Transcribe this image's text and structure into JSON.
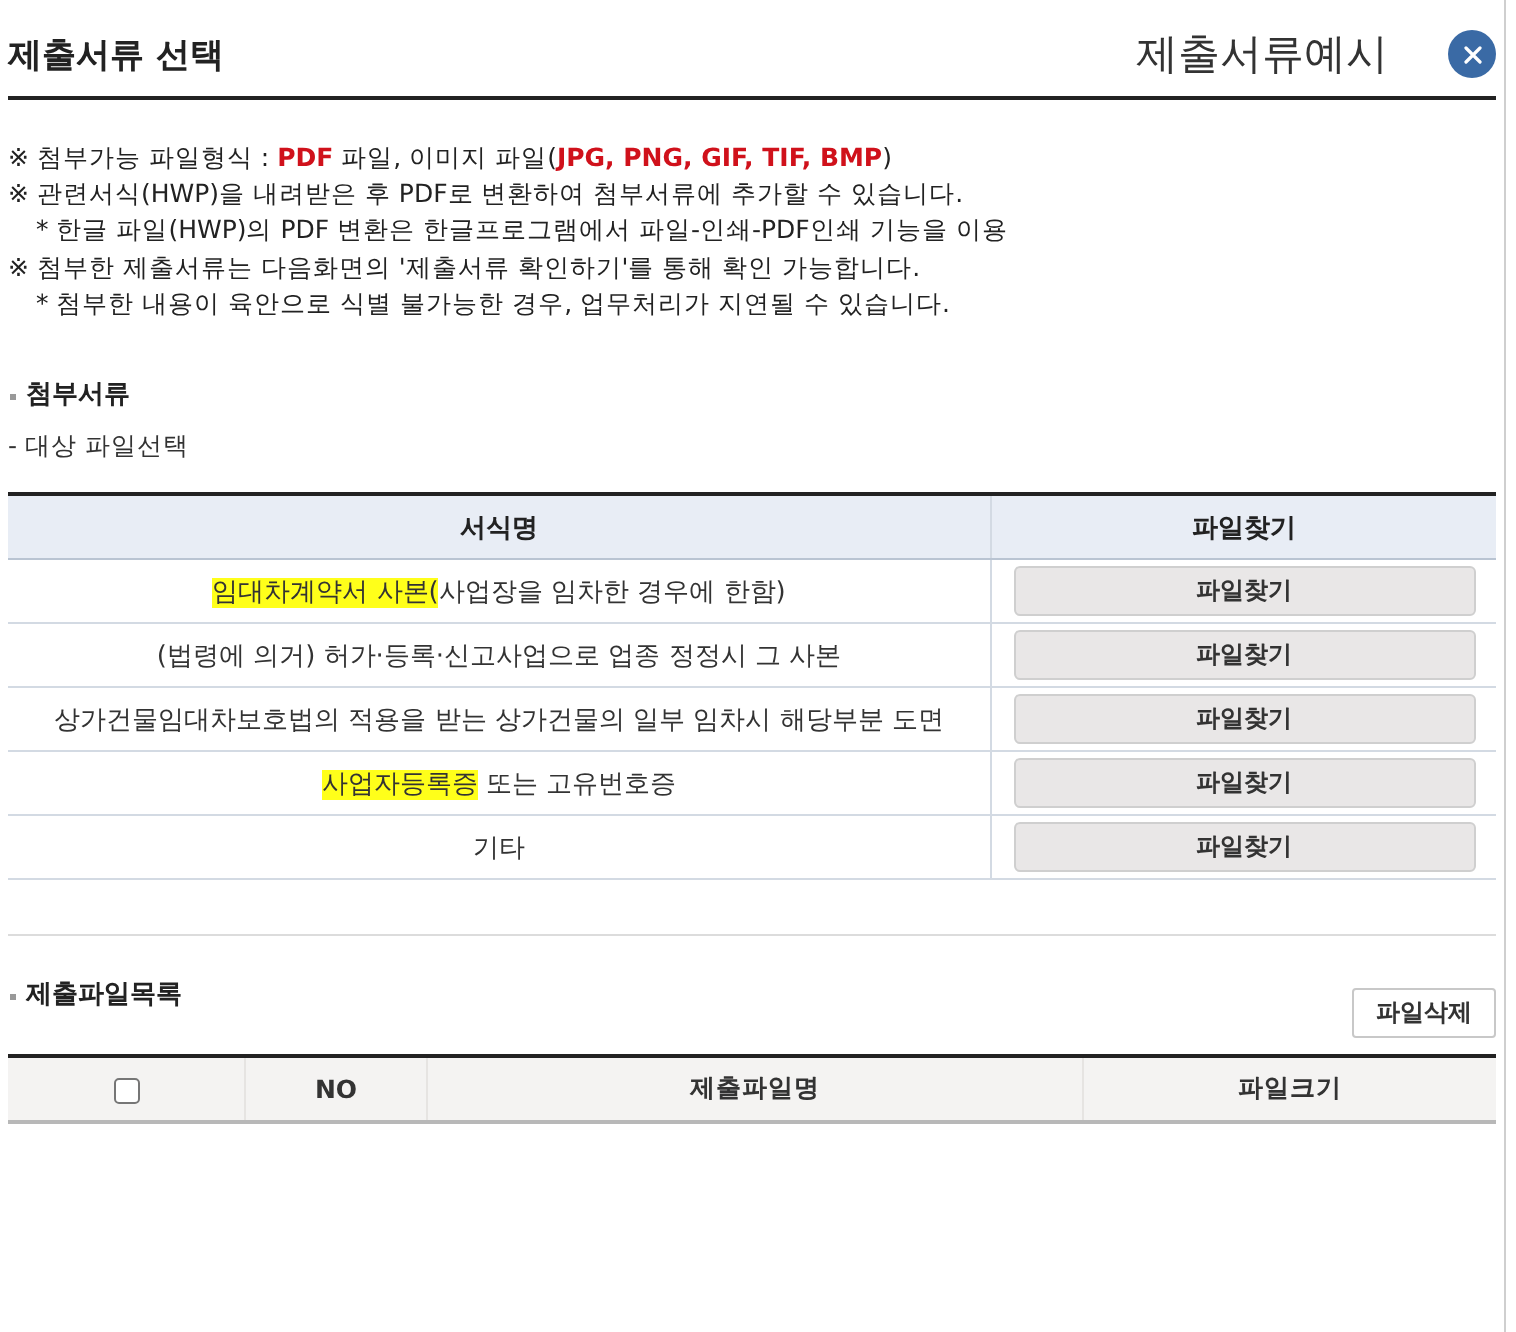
{
  "header": {
    "title": "제출서류 선택",
    "example_link": "제출서류예시"
  },
  "notices": [
    {
      "kind": "note",
      "segments": [
        {
          "text": "※ 첨부가능 파일형식 : ",
          "emphasis": false
        },
        {
          "text": "PDF",
          "emphasis": true
        },
        {
          "text": " 파일, 이미지 파일(",
          "emphasis": false
        },
        {
          "text": "JPG, PNG, GIF, TIF, BMP",
          "emphasis": true
        },
        {
          "text": ")",
          "emphasis": false
        }
      ]
    },
    {
      "kind": "note",
      "segments": [
        {
          "text": "※ 관련서식(HWP)을 내려받은 후 PDF로 변환하여 첨부서류에 추가할 수 있습니다.",
          "emphasis": false
        }
      ]
    },
    {
      "kind": "sub",
      "segments": [
        {
          "text": "* 한글 파일(HWP)의 PDF 변환은 한글프로그램에서 파일-인쇄-PDF인쇄 기능을 이용",
          "emphasis": false
        }
      ]
    },
    {
      "kind": "note",
      "segments": [
        {
          "text": "※ 첨부한 제출서류는 다음화면의 '제출서류 확인하기'를 통해 확인 가능합니다.",
          "emphasis": false
        }
      ]
    },
    {
      "kind": "sub",
      "segments": [
        {
          "text": "* 첨부한 내용이 육안으로 식별 불가능한 경우, 업무처리가 지연될 수 있습니다.",
          "emphasis": false
        }
      ]
    }
  ],
  "attach_section": {
    "title": "첨부서류",
    "subtitle": "- 대상 파일선택",
    "table": {
      "columns": [
        "서식명",
        "파일찾기"
      ],
      "rows": [
        {
          "name": [
            {
              "text": "임대차계약서 사본(",
              "highlighted": true
            },
            {
              "text": "사업장을 임차한 경우에 한함)",
              "highlighted": false
            }
          ],
          "button": "파일찾기"
        },
        {
          "name": [
            {
              "text": "(법령에 의거) 허가·등록·신고사업으로 업종 정정시 그 사본",
              "highlighted": false
            }
          ],
          "button": "파일찾기"
        },
        {
          "name": [
            {
              "text": "상가건물임대차보호법의 적용을 받는 상가건물의 일부 임차시 해당부분 도면",
              "highlighted": false
            }
          ],
          "button": "파일찾기"
        },
        {
          "name": [
            {
              "text": "사업자등록증",
              "highlighted": true
            },
            {
              "text": " 또는 고유번호증",
              "highlighted": false
            }
          ],
          "button": "파일찾기"
        },
        {
          "name": [
            {
              "text": "기타",
              "highlighted": false
            }
          ],
          "button": "파일찾기"
        }
      ]
    }
  },
  "files_section": {
    "title": "제출파일목록",
    "delete_button": "파일삭제",
    "table": {
      "select_all_checked": false,
      "columns": [
        "NO",
        "제출파일명",
        "파일크기"
      ]
    }
  }
}
